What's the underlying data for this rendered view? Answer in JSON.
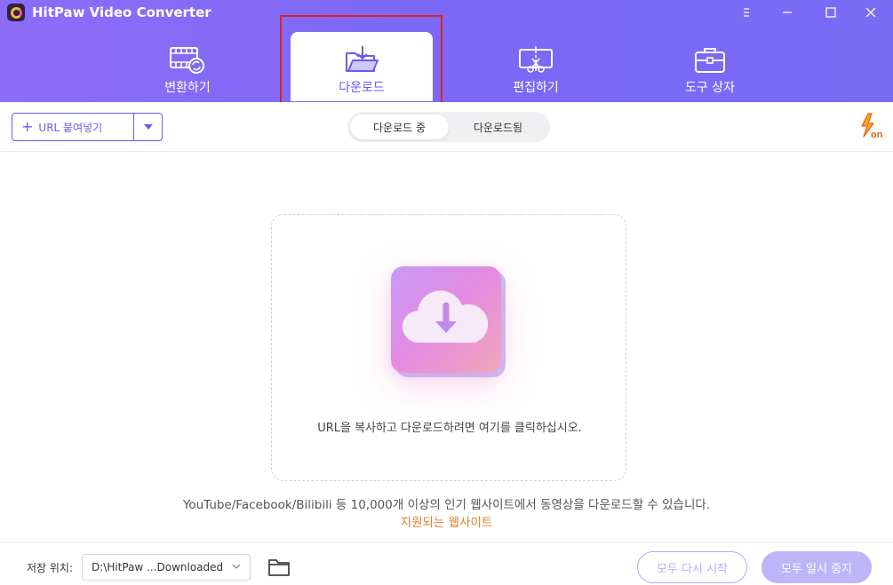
{
  "window": {
    "title": "HitPaw Video Converter",
    "controls": [
      "menu-icon",
      "minimize-icon",
      "maximize-icon",
      "close-icon"
    ]
  },
  "nav": {
    "tabs": [
      {
        "label": "변환하기",
        "icon": "film-convert-icon",
        "active": false
      },
      {
        "label": "다운로드",
        "icon": "download-folder-icon",
        "active": true
      },
      {
        "label": "편집하기",
        "icon": "edit-cut-icon",
        "active": false
      },
      {
        "label": "도구 상자",
        "icon": "toolbox-icon",
        "active": false
      }
    ]
  },
  "toolbar": {
    "url_button": "URL 붙여넣기",
    "segments": [
      {
        "label": "다운로드 중",
        "active": true
      },
      {
        "label": "다운로드됨",
        "active": false
      }
    ],
    "turbo_icon": "turbo-on-icon"
  },
  "main": {
    "drop_text": "URL을 복사하고 다운로드하려면 여기를 클릭하십시오.",
    "info_text": "YouTube/Facebook/Bilibili 등 10,000개 이상의 인기 웹사이트에서 동영상을 다운로드할 수 있습니다.",
    "sites_link": "지원되는 웹사이트"
  },
  "footer": {
    "save_label": "저장 위치:",
    "path": "D:\\HitPaw ...Downloaded",
    "resume_all": "모두 다시 시작",
    "pause_all": "모두 일시 중지"
  },
  "colors": {
    "accent": "#6a5cf2",
    "header_bg": "#8170f6",
    "link": "#d9822b",
    "highlight": "#e0201f"
  }
}
